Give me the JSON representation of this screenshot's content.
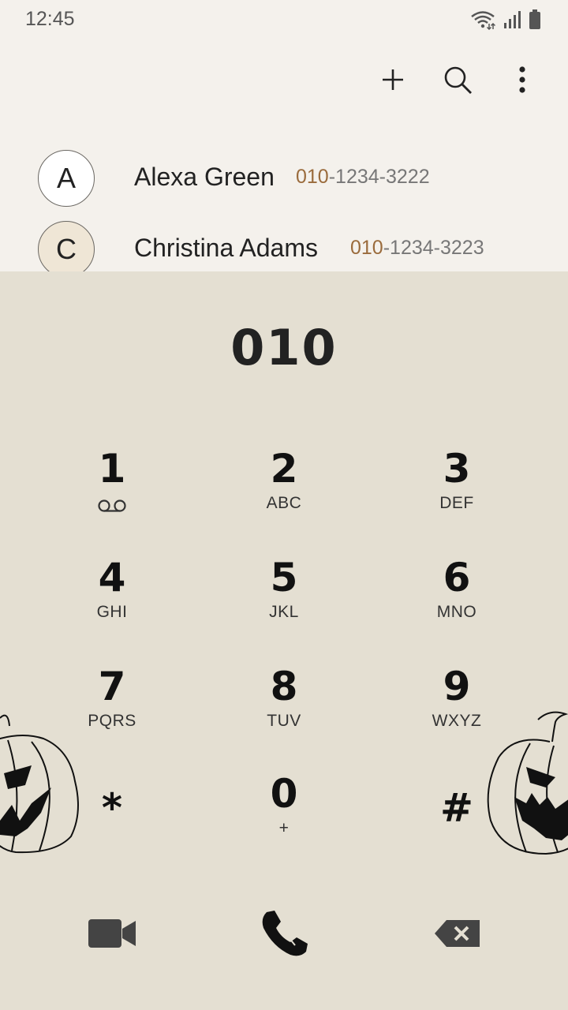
{
  "status_bar": {
    "time": "12:45",
    "icons": [
      "wifi-icon",
      "signal-icon",
      "battery-icon"
    ]
  },
  "toolbar": {
    "add": "plus-icon",
    "search": "search-icon",
    "more": "more-vert-icon"
  },
  "contacts": [
    {
      "initial": "A",
      "name": "Alexa Green",
      "number_match": "010",
      "number_rest": "-1234-3222",
      "avatar_color": "#ffffff"
    },
    {
      "initial": "C",
      "name": "Christina Adams",
      "number_match": "010",
      "number_rest": "-1234-3223",
      "avatar_color": "#efe6d6"
    }
  ],
  "dialer": {
    "entered_number": "010",
    "keys": [
      {
        "digit": "1",
        "letters": ""
      },
      {
        "digit": "2",
        "letters": "ABC"
      },
      {
        "digit": "3",
        "letters": "DEF"
      },
      {
        "digit": "4",
        "letters": "GHI"
      },
      {
        "digit": "5",
        "letters": "JKL"
      },
      {
        "digit": "6",
        "letters": "MNO"
      },
      {
        "digit": "7",
        "letters": "PQRS"
      },
      {
        "digit": "8",
        "letters": "TUV"
      },
      {
        "digit": "9",
        "letters": "WXYZ"
      },
      {
        "digit": "*",
        "letters": ""
      },
      {
        "digit": "0",
        "letters": "+"
      },
      {
        "digit": "#",
        "letters": ""
      }
    ],
    "actions": [
      "video-call-icon",
      "call-icon",
      "backspace-icon"
    ]
  },
  "colors": {
    "background": "#f4f1ec",
    "dialer_background": "#e4dfd2",
    "number_highlight": "#9a6b3c"
  }
}
